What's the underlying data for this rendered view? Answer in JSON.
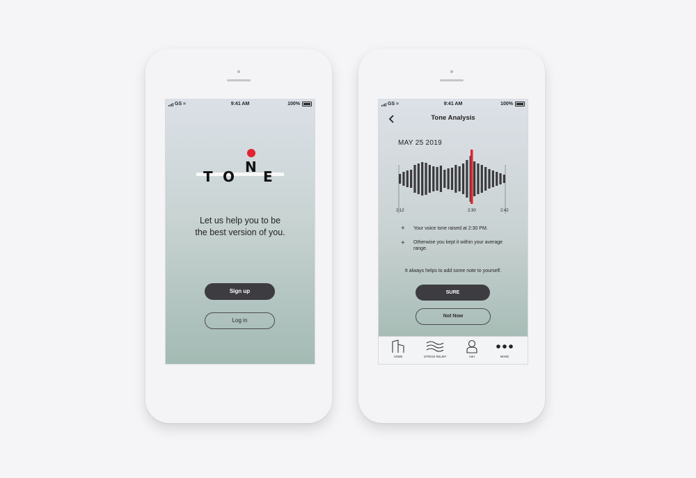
{
  "left_screen": {
    "status": {
      "carrier": "GS",
      "time": "9:41 AM",
      "battery": "100%"
    },
    "logo_text": "TONE",
    "tagline_line1": "Let us help you to be",
    "tagline_line2": "the best version of you.",
    "signup_label": "Sign up",
    "login_label": "Log in"
  },
  "right_screen": {
    "status": {
      "carrier": "GS",
      "time": "9:41 AM",
      "battery": "100%"
    },
    "title": "Tone Analysis",
    "date": "MAY 25 2019",
    "waveform": {
      "start_time": "2:12",
      "marker_time": "2:30",
      "end_time": "2:42",
      "marker_color": "#e3232f"
    },
    "notes": [
      {
        "text": "Your voice tone raised at 2:30 PM."
      },
      {
        "text": "Otherwise you kept it within your average range."
      }
    ],
    "prompt": "It always helps to add some note to yourself.",
    "sure_label": "SURE",
    "not_now_label": "Not Now",
    "tabs": [
      {
        "label": "HOME",
        "icon": "home-icon"
      },
      {
        "label": "STRESS RELIEF",
        "icon": "waves-icon"
      },
      {
        "label": "ASH",
        "icon": "person-icon"
      },
      {
        "label": "MORE",
        "icon": "more-icon"
      }
    ]
  },
  "colors": {
    "accent": "#e3232f",
    "button_dark": "#3d3c41"
  }
}
